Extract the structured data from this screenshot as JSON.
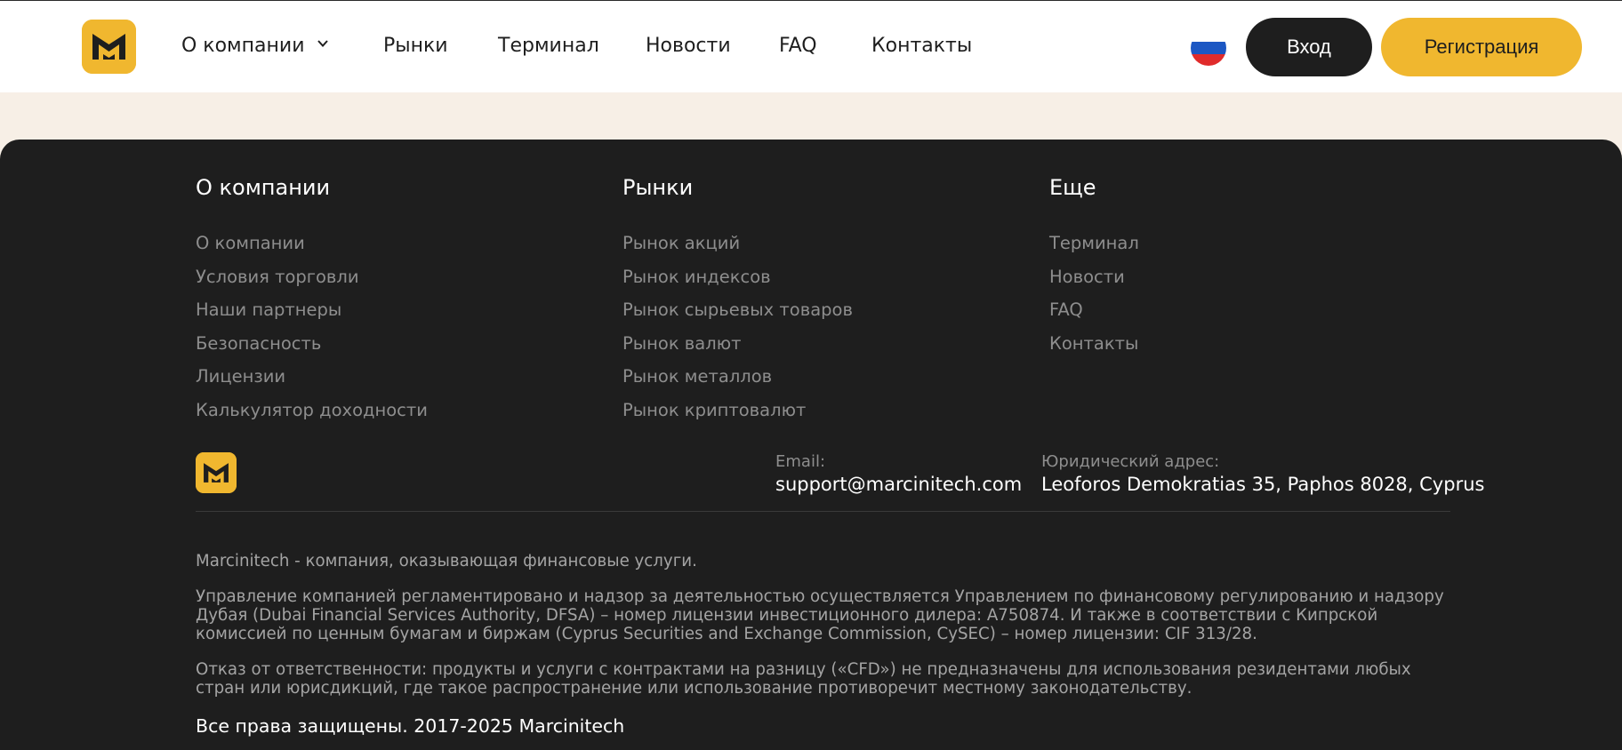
{
  "header": {
    "logo_icon": "marcinitech-m-logo",
    "nav": [
      {
        "label": "О компании",
        "has_dropdown": true
      },
      {
        "label": "Рынки"
      },
      {
        "label": "Терминал"
      },
      {
        "label": "Новости"
      },
      {
        "label": "FAQ"
      },
      {
        "label": "Контакты"
      }
    ],
    "language_icon": "russian-flag-icon",
    "login_label": "Вход",
    "register_label": "Регистрация"
  },
  "footer": {
    "columns": [
      {
        "title": "О компании",
        "links": [
          "О компании",
          "Условия торговли",
          "Наши партнеры",
          "Безопасность",
          "Лицензии",
          "Калькулятор доходности"
        ]
      },
      {
        "title": "Рынки",
        "links": [
          "Рынок акций",
          "Рынок индексов",
          "Рынок сырьевых товаров",
          "Рынок валют",
          "Рынок металлов",
          "Рынок криптовалют"
        ]
      },
      {
        "title": "Еще",
        "links": [
          "Терминал",
          "Новости",
          "FAQ",
          "Контакты"
        ]
      }
    ],
    "email_label": "Email:",
    "email_value": "support@marcinitech.com",
    "address_label": "Юридический адрес:",
    "address_value": "Leoforos Demokratias 35, Paphos 8028, Cyprus",
    "legal": [
      "Marcinitech - компания, оказывающая финансовые услуги.",
      "Управление компанией регламентировано и надзор за деятельностью осуществляется Управлением по финансовому регулированию и надзору Дубая (Dubai Financial Services Authority, DFSA) – номер лицензии инвестиционного дилера: A750874. И также в соответствии с Кипрской комиссией по ценным бумагам и биржам (Cyprus Securities and Exchange Commission, CySEC) – номер лицензии: CIF 313/28.",
      "Отказ от ответственности: продукты и услуги с контрактами на разницу («CFD») не предназначены для использования резидентами любых стран или юрисдикций, где такое распространение или использование противоречит местному законодательству."
    ],
    "copyright": "Все права защищены. 2017-2025 Marcinitech"
  },
  "colors": {
    "accent": "#f0b72f",
    "dark": "#1e1e1e",
    "page_background": "#f7efe6",
    "muted_text": "#8e8e8e"
  }
}
